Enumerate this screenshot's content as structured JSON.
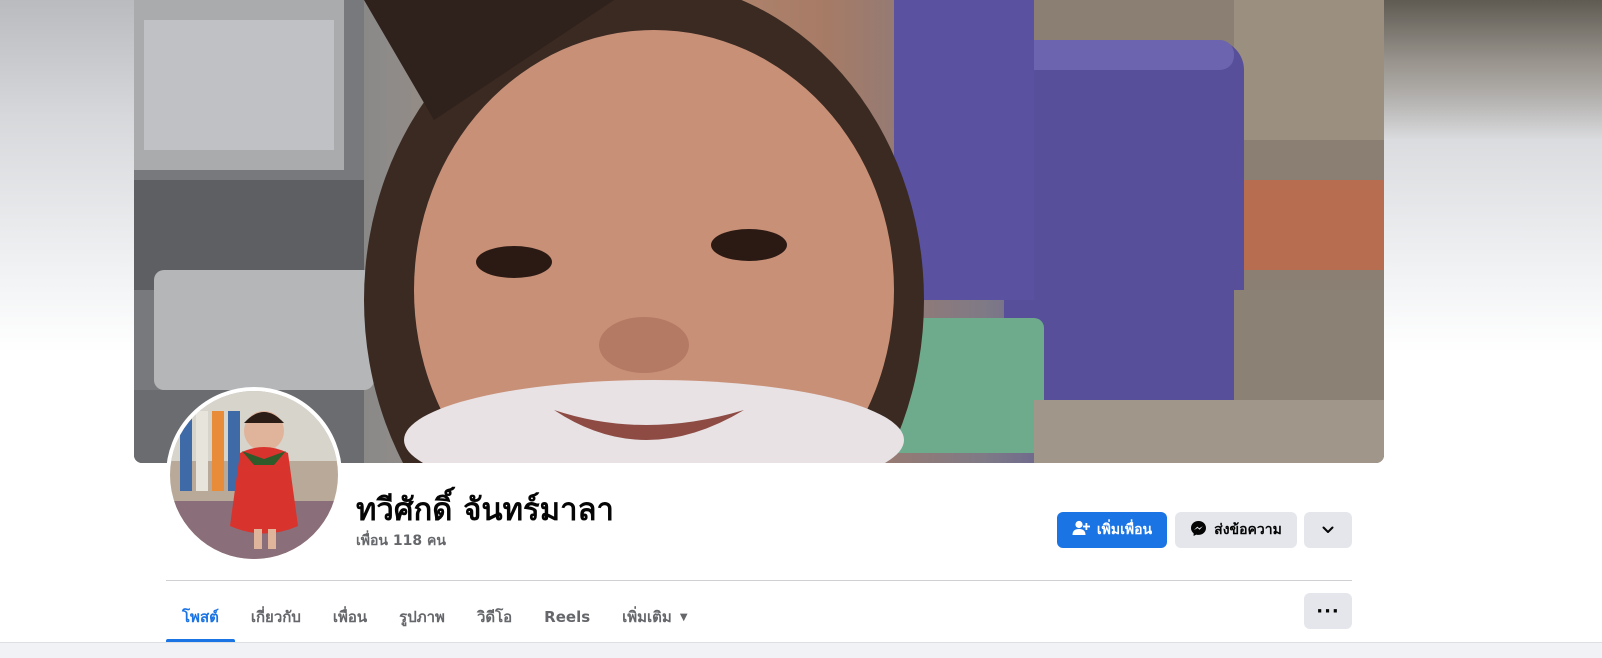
{
  "profile": {
    "name": "ทวีศักดิ์ จันทร์มาลา",
    "friends_count": "เพื่อน 118 คน"
  },
  "actions": {
    "add_friend_label": "เพิ่มเพื่อน",
    "message_label": "ส่งข้อความ",
    "more_icon": "chevron-down-icon"
  },
  "tabs": [
    {
      "label": "โพสต์",
      "active": true
    },
    {
      "label": "เกี่ยวกับ",
      "active": false
    },
    {
      "label": "เพื่อน",
      "active": false
    },
    {
      "label": "รูปภาพ",
      "active": false
    },
    {
      "label": "วิดีโอ",
      "active": false
    },
    {
      "label": "Reels",
      "active": false
    },
    {
      "label": "เพิ่มเติม",
      "active": false
    }
  ],
  "tab_overflow_icon": "more-dots-icon",
  "colors": {
    "accent": "#1b74e4",
    "button_gray": "#e4e6eb",
    "text_primary": "#050505",
    "text_secondary": "#65676b"
  }
}
